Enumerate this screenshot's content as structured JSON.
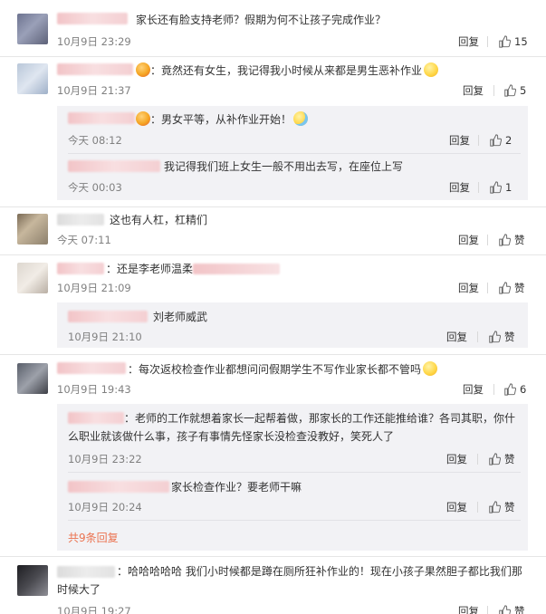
{
  "comments": [
    {
      "text": "家长还有脸支持老师？假期为何不让孩子完成作业？",
      "time": "10月9日 23:29",
      "reply": "回复",
      "likes": "15"
    },
    {
      "text": "：竟然还有女生，我记得我小时候从来都是男生恶补作业",
      "time": "10月9日 21:37",
      "reply": "回复",
      "likes": "5",
      "subs": [
        {
          "text": "：男女平等，从补作业开始！",
          "time": "今天 08:12",
          "reply": "回复",
          "likes": "2"
        },
        {
          "text": "我记得我们班上女生一般不用出去写，在座位上写",
          "time": "今天 00:03",
          "reply": "回复",
          "likes": "1"
        }
      ]
    },
    {
      "text": "这也有人杠，杠精们",
      "time": "今天 07:11",
      "reply": "回复",
      "likes": "赞"
    },
    {
      "text": "：还是李老师温柔",
      "time": "10月9日 21:09",
      "reply": "回复",
      "likes": "赞",
      "subs": [
        {
          "text": "刘老师威武",
          "time": "10月9日 21:10",
          "reply": "回复",
          "likes": "赞"
        }
      ]
    },
    {
      "text": "：每次返校检查作业都想问问假期学生不写作业家长都不管吗",
      "time": "10月9日 19:43",
      "reply": "回复",
      "likes": "6",
      "subs": [
        {
          "text": "：老师的工作就想着家长一起帮着做，那家长的工作还能推给谁？各司其职，你什么职业就该做什么事，孩子有事情先怪家长没检查没教好，笑死人了",
          "time": "10月9日 23:22",
          "reply": "回复",
          "likes": "赞"
        },
        {
          "text": "家长检查作业？要老师干嘛",
          "time": "10月9日 20:24",
          "reply": "回复",
          "likes": "赞"
        }
      ],
      "more_replies": "共9条回复"
    },
    {
      "text": "：哈哈哈哈哈 我们小时候都是蹲在厕所狂补作业的！现在小孩子果然胆子都比我们那时候大了",
      "time": "10月9日 19:27",
      "reply": "回复",
      "likes": "赞"
    }
  ]
}
